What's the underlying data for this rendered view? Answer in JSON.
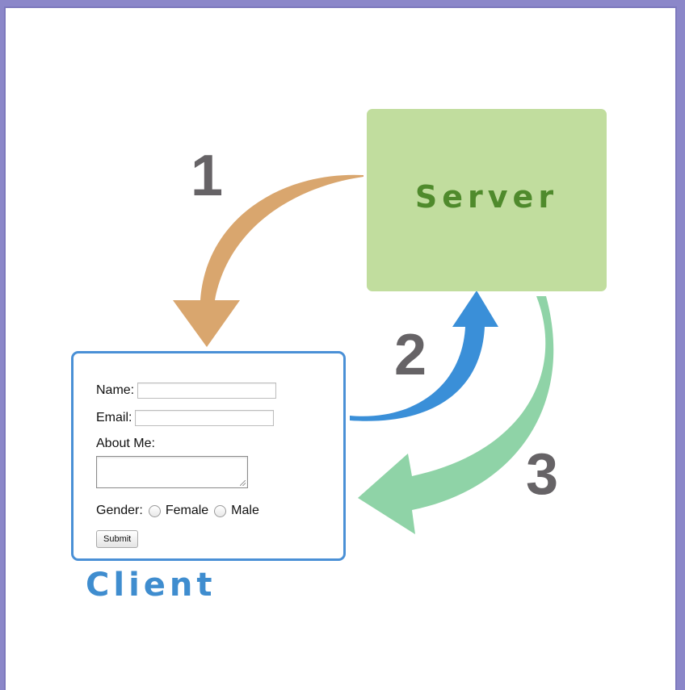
{
  "server": {
    "label": "Server"
  },
  "client": {
    "label": "Client",
    "form": {
      "name_label": "Name:",
      "email_label": "Email:",
      "about_label": "About Me:",
      "gender_label": "Gender:",
      "gender_options": [
        "Female",
        "Male"
      ],
      "submit_label": "Submit"
    }
  },
  "steps": [
    "1",
    "2",
    "3"
  ],
  "colors": {
    "frame": "#8b87c9",
    "server_fill": "#c1dd9e",
    "server_text": "#4f8a2c",
    "client_border": "#4a90d6",
    "client_text": "#3f8dcf",
    "arrow_1": "#d9a66e",
    "arrow_2": "#3a8fd8",
    "arrow_3": "#8fd3a7",
    "step_numbers": "#666366"
  }
}
